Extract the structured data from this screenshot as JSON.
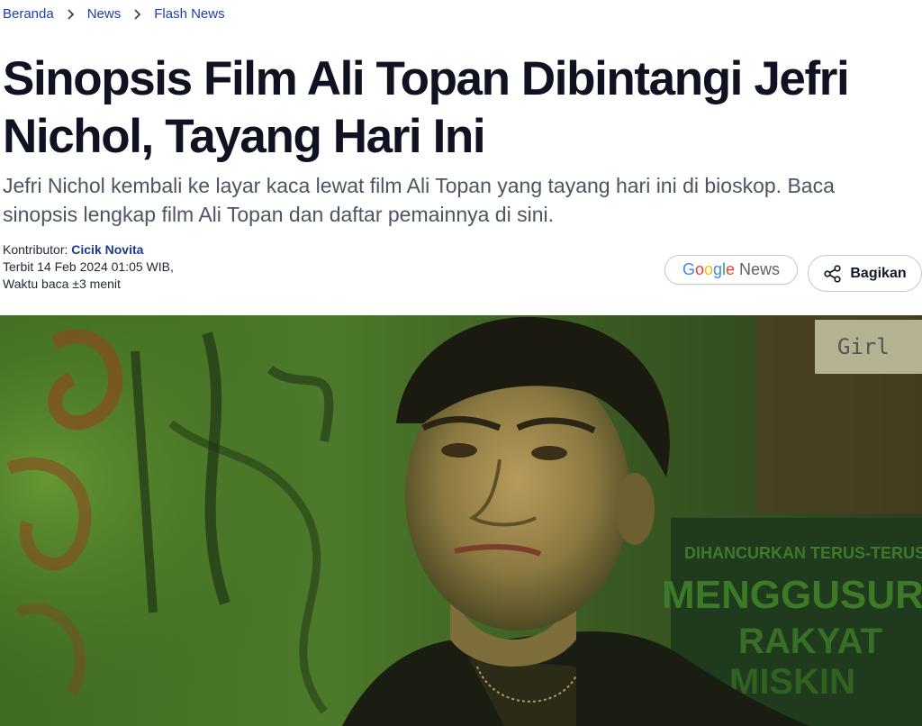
{
  "breadcrumb": {
    "items": [
      "Beranda",
      "News",
      "Flash News"
    ]
  },
  "article": {
    "title": "Sinopsis Film Ali Topan Dibintangi Jefri Nichol, Tayang Hari Ini",
    "lede": "Jefri Nichol kembali ke layar kaca lewat film Ali Topan yang tayang hari ini di bioskop. Baca sinopsis lengkap film Ali Topan dan daftar pemainnya di sini.",
    "contributor_label": "Kontributor:",
    "contributor_name": "Cicik Novita",
    "published": "Terbit 14 Feb 2024 01:05 WIB,",
    "read_time": "Waktu baca ±3 menit"
  },
  "actions": {
    "google_news_logo": "Google",
    "google_news_word": "News",
    "share_label": "Bagikan"
  },
  "hero_image": {
    "sign_text_top": "Girl",
    "sign_text_1": "DIHANCURKAN TERUS-TERUS",
    "sign_text_2": "MENGGUSUR",
    "sign_text_3": "RAKYAT",
    "sign_text_4": "MISKIN"
  },
  "colors": {
    "link": "#1e40af",
    "author": "#1e3a8a",
    "google_blue": "#4285F4",
    "google_red": "#EA4335",
    "google_yellow": "#FBBC05",
    "google_green": "#34A853"
  }
}
